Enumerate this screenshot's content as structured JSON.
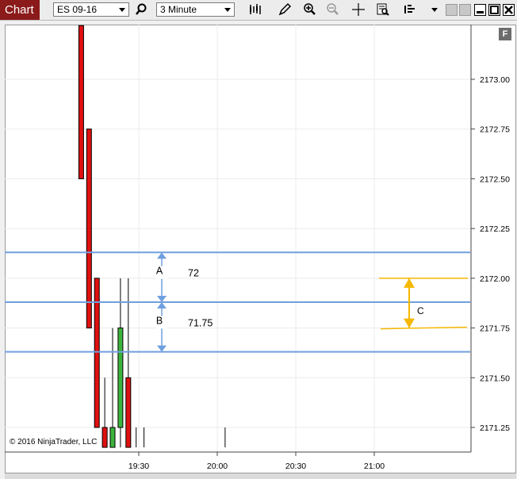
{
  "toolbar": {
    "title": "Chart",
    "instrument": "ES 09-16",
    "interval": "3 Minute",
    "icons": [
      "search-icon",
      "bar-type-icon",
      "draw-icon",
      "zoom-in-icon",
      "zoom-out-icon",
      "crosshair-icon",
      "data-box-icon",
      "chart-trader-icon",
      "dropdown-icon"
    ]
  },
  "window": {
    "buttons": [
      "restore",
      "minimize",
      "maximize",
      "close"
    ]
  },
  "chart": {
    "flag_label": "F",
    "copyright": "© 2016 NinjaTrader, LLC"
  },
  "colors": {
    "up": "#3cb43c",
    "down": "#e01010",
    "lines": "#6f9fdf",
    "annotation": "#f5b800"
  },
  "chart_data": {
    "type": "candlestick",
    "y_ticks": [
      "2173.00",
      "2172.75",
      "2172.50",
      "2172.25",
      "2172.00",
      "2171.75",
      "2171.50",
      "2171.25"
    ],
    "y_range": [
      2171.15,
      2173.27
    ],
    "x_ticks": [
      "19:30",
      "20:00",
      "20:30",
      "21:00"
    ],
    "x_range": [
      "19:01",
      "21:36"
    ],
    "candles": [
      {
        "t": "19:08",
        "open": 2173.27,
        "high": 2173.27,
        "low": 2172.5,
        "close": 2172.5
      },
      {
        "t": "19:11",
        "open": 2172.75,
        "high": 2172.75,
        "low": 2171.75,
        "close": 2171.75
      },
      {
        "t": "19:14",
        "open": 2172.0,
        "high": 2172.0,
        "low": 2171.25,
        "close": 2171.25
      },
      {
        "t": "19:17",
        "open": 2171.25,
        "high": 2171.5,
        "low": 2171.15,
        "close": 2171.15
      },
      {
        "t": "19:20",
        "open": 2171.15,
        "high": 2171.75,
        "low": 2171.15,
        "close": 2171.25
      },
      {
        "t": "19:23",
        "open": 2171.25,
        "high": 2172.0,
        "low": 2171.15,
        "close": 2171.75
      },
      {
        "t": "19:26",
        "open": 2171.5,
        "high": 2172.0,
        "low": 2171.15,
        "close": 2171.15
      },
      {
        "t": "19:29",
        "open": 2171.25,
        "high": 2171.25,
        "low": 2171.15,
        "close": 2171.25
      },
      {
        "t": "19:32",
        "open": 2171.25,
        "high": 2171.25,
        "low": 2171.15,
        "close": 2171.25
      },
      {
        "t": "20:03",
        "open": 2171.25,
        "high": 2171.25,
        "low": 2171.15,
        "close": 2171.25
      }
    ],
    "horizontal_lines": [
      2172.13,
      2171.88,
      2171.63
    ],
    "measure_a": {
      "label": "A",
      "value": "72",
      "top": 2172.13,
      "bottom": 2171.88
    },
    "measure_b": {
      "label": "B",
      "value": "71.75",
      "top": 2171.88,
      "bottom": 2171.63
    },
    "range_c": {
      "label": "C",
      "top": 2172.0,
      "bottom": 2171.75
    }
  }
}
